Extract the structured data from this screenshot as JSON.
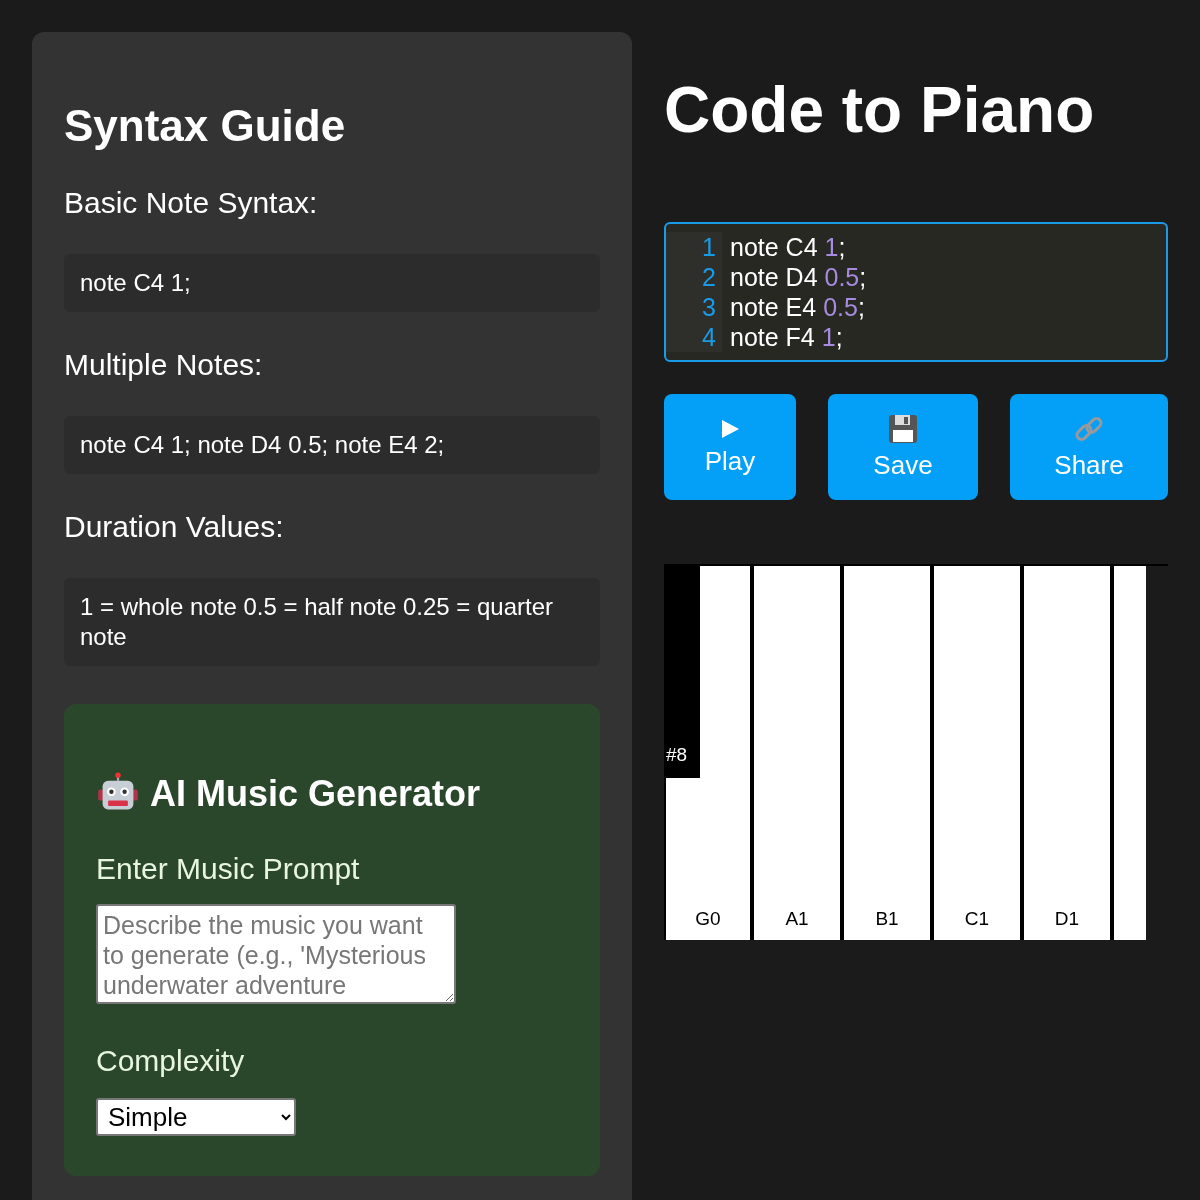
{
  "syntax_guide": {
    "title": "Syntax Guide",
    "sections": [
      {
        "heading": "Basic Note Syntax:",
        "example": "note C4 1;"
      },
      {
        "heading": "Multiple Notes:",
        "example": "note C4 1; note D4 0.5; note E4 2;"
      },
      {
        "heading": "Duration Values:",
        "example": "1 = whole note 0.5 = half note 0.25 = quarter note"
      }
    ],
    "generator": {
      "title": "AI Music Generator",
      "prompt_label": "Enter Music Prompt",
      "prompt": {
        "placeholder": "Describe the music you want to generate (e.g., 'Mysterious underwater adventure"
      },
      "complexity_label": "Complexity",
      "complexity": {
        "value": "Simple"
      }
    }
  },
  "app_title": "Code to Piano",
  "editor": {
    "lines": [
      {
        "number": "1",
        "code": "note C4",
        "value": "1",
        "end": ";"
      },
      {
        "number": "2",
        "code": "note D4",
        "value": "0.5",
        "end": ";"
      },
      {
        "number": "3",
        "code": "note E4",
        "value": "0.5",
        "end": ";"
      },
      {
        "number": "4",
        "code": "note F4",
        "value": "1",
        "end": ";"
      }
    ]
  },
  "buttons": [
    {
      "kind": "play",
      "label": "Play"
    },
    {
      "kind": "save",
      "label": "Save"
    },
    {
      "kind": "share",
      "label": "Share"
    }
  ],
  "piano": {
    "keys": [
      {
        "kind": "white",
        "label": "G0"
      },
      {
        "kind": "white",
        "label": "A1"
      },
      {
        "kind": "white",
        "label": "B1"
      },
      {
        "kind": "white",
        "label": "C1"
      },
      {
        "kind": "white",
        "label": "D1"
      },
      {
        "kind": "white"
      }
    ],
    "black_keys": [
      {
        "label": "#8"
      }
    ]
  }
}
